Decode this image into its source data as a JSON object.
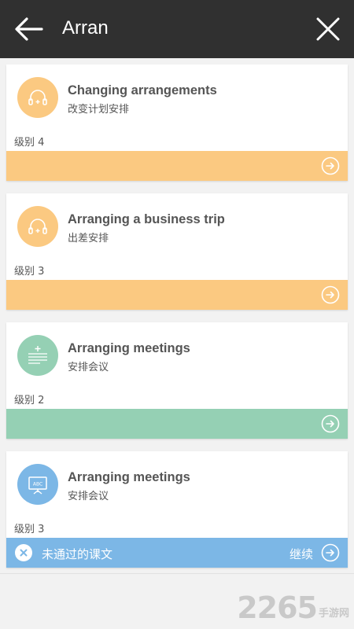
{
  "header": {
    "title": "Arran"
  },
  "colors": {
    "orange": "#fbc981",
    "green": "#95d0b4",
    "blue": "#7cb7e6",
    "topbar": "#303030"
  },
  "lessons": [
    {
      "title": "Changing arrangements",
      "subtitle": "改变计划安排",
      "level": "级别 4",
      "icon": "headphones-icon"
    },
    {
      "title": "Arranging a business trip",
      "subtitle": "出差安排",
      "level": "级别 3",
      "icon": "headphones-icon"
    },
    {
      "title": "Arranging meetings",
      "subtitle": "安排会议",
      "level": "级别 2",
      "icon": "text-lines-icon"
    },
    {
      "title": "Arranging meetings",
      "subtitle": "安排会议",
      "level": "级别 3",
      "icon": "whiteboard-icon",
      "badge_text": "ABC"
    }
  ],
  "failed_bar": {
    "label": "未通过的课文",
    "continue": "继续"
  },
  "watermark": {
    "number": "2265",
    "text": "手游网"
  }
}
